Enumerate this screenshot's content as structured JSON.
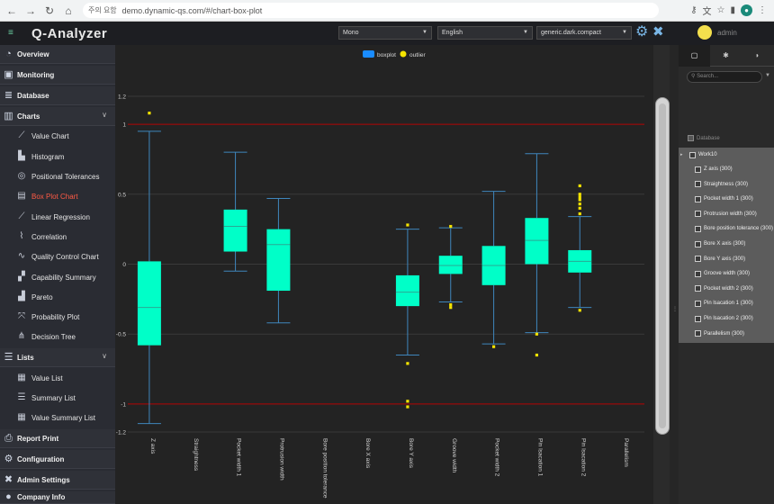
{
  "browser": {
    "secure_label": "주의 요함",
    "url": "demo.dynamic-qs.com/#/chart-box-plot"
  },
  "header": {
    "logo": "Q-Analyzer",
    "select_theme": "Mono",
    "select_language": "English",
    "select_style": "generic.dark.compact",
    "user": "admin"
  },
  "sidebar": {
    "main": [
      {
        "label": "Overview",
        "icon": "pie-chart-icon"
      },
      {
        "label": "Monitoring",
        "icon": "monitor-icon"
      },
      {
        "label": "Database",
        "icon": "database-icon"
      },
      {
        "label": "Charts",
        "icon": "bar-chart-icon"
      },
      {
        "label": "Lists",
        "icon": "list-icon"
      },
      {
        "label": "Report Print",
        "icon": "printer-icon"
      },
      {
        "label": "Configuration",
        "icon": "gear-icon"
      },
      {
        "label": "Admin Settings",
        "icon": "tools-icon"
      },
      {
        "label": "Company Info",
        "icon": "person-icon"
      }
    ],
    "charts_sub": [
      "Value Chart",
      "Histogram",
      "Positional Tolerances",
      "Box Plot Chart",
      "Linear Regression",
      "Correlation",
      "Quality Control Chart",
      "Capability Summary",
      "Pareto",
      "Probability Plot",
      "Decision Tree"
    ],
    "lists_sub": [
      "Value List",
      "Summary List",
      "Value Summary List"
    ]
  },
  "chart_data": {
    "type": "boxplot",
    "legend": [
      "boxplot",
      "outlier"
    ],
    "ylim": [
      -1.2,
      1.2
    ],
    "yticks": [
      1.2,
      1,
      0.5,
      0,
      -0.5,
      -1,
      -1.2
    ],
    "limit_lines": [
      1,
      -1
    ],
    "categories": [
      "Z axis",
      "Straightness",
      "Pocket width 1",
      "Protrusion width",
      "Bore position tolerance",
      "Bore X axis",
      "Bore Y axis",
      "Groove width",
      "Pocket width 2",
      "Pin lsacation 1",
      "Pin lsacation 2",
      "Parallelism"
    ],
    "boxes": [
      {
        "cat": 0,
        "min": -1.14,
        "q1": -0.58,
        "median": -0.31,
        "q3": 0.02,
        "max": 0.95,
        "outliers": [
          1.08
        ]
      },
      {
        "cat": 2,
        "min": -0.05,
        "q1": 0.09,
        "median": 0.27,
        "q3": 0.39,
        "max": 0.8,
        "outliers": []
      },
      {
        "cat": 3,
        "min": -0.42,
        "q1": -0.19,
        "median": 0.14,
        "q3": 0.25,
        "max": 0.47,
        "outliers": []
      },
      {
        "cat": 6,
        "min": -0.65,
        "q1": -0.3,
        "median": -0.2,
        "q3": -0.08,
        "max": 0.25,
        "outliers": [
          -0.71,
          -0.98,
          -1.02,
          0.28
        ]
      },
      {
        "cat": 7,
        "min": -0.27,
        "q1": -0.07,
        "median": -0.01,
        "q3": 0.06,
        "max": 0.26,
        "outliers": [
          -0.29,
          -0.31,
          0.27
        ]
      },
      {
        "cat": 8,
        "min": -0.57,
        "q1": -0.15,
        "median": -0.01,
        "q3": 0.13,
        "max": 0.52,
        "outliers": [
          -0.59
        ]
      },
      {
        "cat": 9,
        "min": -0.49,
        "q1": 0.0,
        "median": 0.17,
        "q3": 0.33,
        "max": 0.79,
        "outliers": [
          -0.5,
          -0.65
        ]
      },
      {
        "cat": 10,
        "min": -0.31,
        "q1": -0.06,
        "median": 0.02,
        "q3": 0.1,
        "max": 0.34,
        "outliers": [
          0.36,
          0.4,
          0.43,
          0.46,
          0.48,
          0.5,
          0.56,
          -0.33
        ]
      }
    ]
  },
  "right_panel": {
    "search_placeholder": "Search...",
    "database_label": "Database",
    "root": "Work10",
    "items": [
      "Z axis (300)",
      "Straightness (300)",
      "Pocket width 1 (300)",
      "Protrusion width (300)",
      "Bore position tolerance (300)",
      "Bore X axis (300)",
      "Bore Y axis (300)",
      "Groove width (300)",
      "Pocket width 2 (300)",
      "Pin lsacation 1 (300)",
      "Pin lsacation 2 (300)",
      "Parallelism (300)"
    ]
  },
  "colors": {
    "box_fill": "#00ffc8",
    "whisker": "#3f86bd",
    "limit_line": "#b00000",
    "outlier": "#f5e400",
    "legend_box": "#1a8cff",
    "active_menu": "#ff5a45"
  }
}
